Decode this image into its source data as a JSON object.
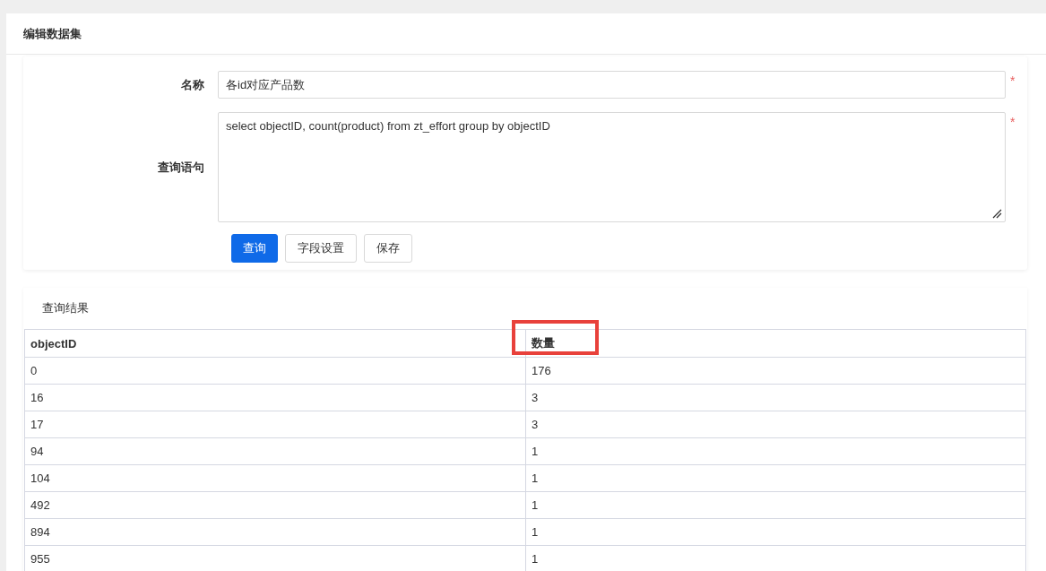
{
  "page_title": "编辑数据集",
  "form": {
    "fields": [
      {
        "label": "名称",
        "kind": "input",
        "value": "各id对应产品数",
        "required": true,
        "required_mark": "*"
      },
      {
        "label": "查询语句",
        "kind": "textarea",
        "value": "select objectID, count(product) from zt_effort group by objectID",
        "required": true,
        "required_mark": "*"
      }
    ],
    "buttons": [
      {
        "label": "查询",
        "primary": true
      },
      {
        "label": "字段设置",
        "primary": false
      },
      {
        "label": "保存",
        "primary": false
      }
    ]
  },
  "results": {
    "title": "查询结果",
    "columns": [
      {
        "label": "objectID",
        "highlighted": false
      },
      {
        "label": "数量",
        "highlighted": true
      }
    ],
    "rows": [
      [
        "0",
        "176"
      ],
      [
        "16",
        "3"
      ],
      [
        "17",
        "3"
      ],
      [
        "94",
        "1"
      ],
      [
        "104",
        "1"
      ],
      [
        "492",
        "1"
      ],
      [
        "894",
        "1"
      ],
      [
        "955",
        "1"
      ]
    ]
  }
}
